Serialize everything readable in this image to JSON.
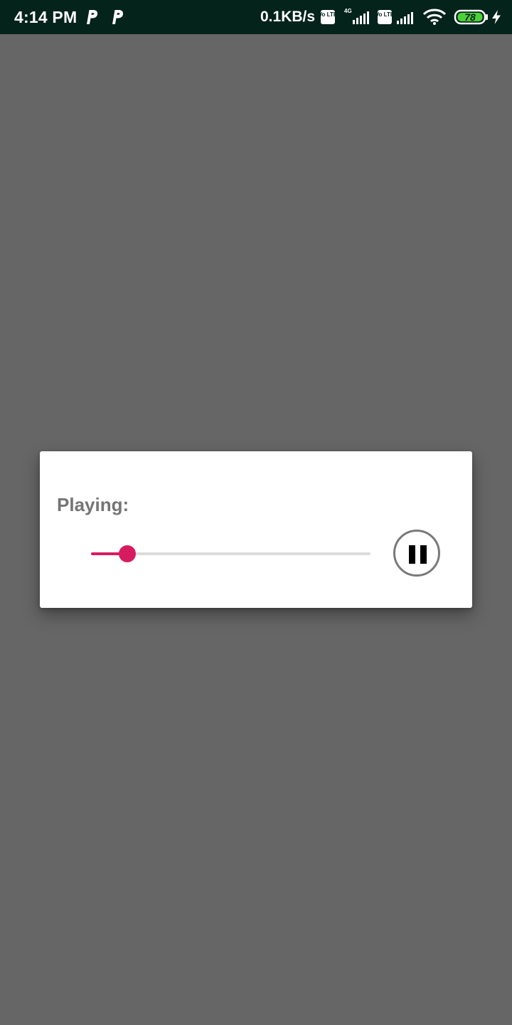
{
  "status_bar": {
    "time": "4:14 PM",
    "network_speed": "0.1KB/s",
    "sim1_label": "Vo LTE",
    "sim1_network": "4G",
    "sim2_label": "Vo LTE",
    "battery_level": "78",
    "icons": [
      "parking-p-icon",
      "parking-p-icon",
      "volte-icon",
      "signal-icon",
      "volte-icon",
      "signal-icon",
      "wifi-icon",
      "battery-icon",
      "charging-icon"
    ],
    "background_color": "#04231b"
  },
  "dialog": {
    "title": "Playing:",
    "seekbar": {
      "progress_fraction": 0.13,
      "accent_color": "#d81b60",
      "track_color": "#dcdcdc"
    },
    "pause_button": {
      "icon": "pause-icon"
    }
  },
  "overlay_color": "#666666"
}
